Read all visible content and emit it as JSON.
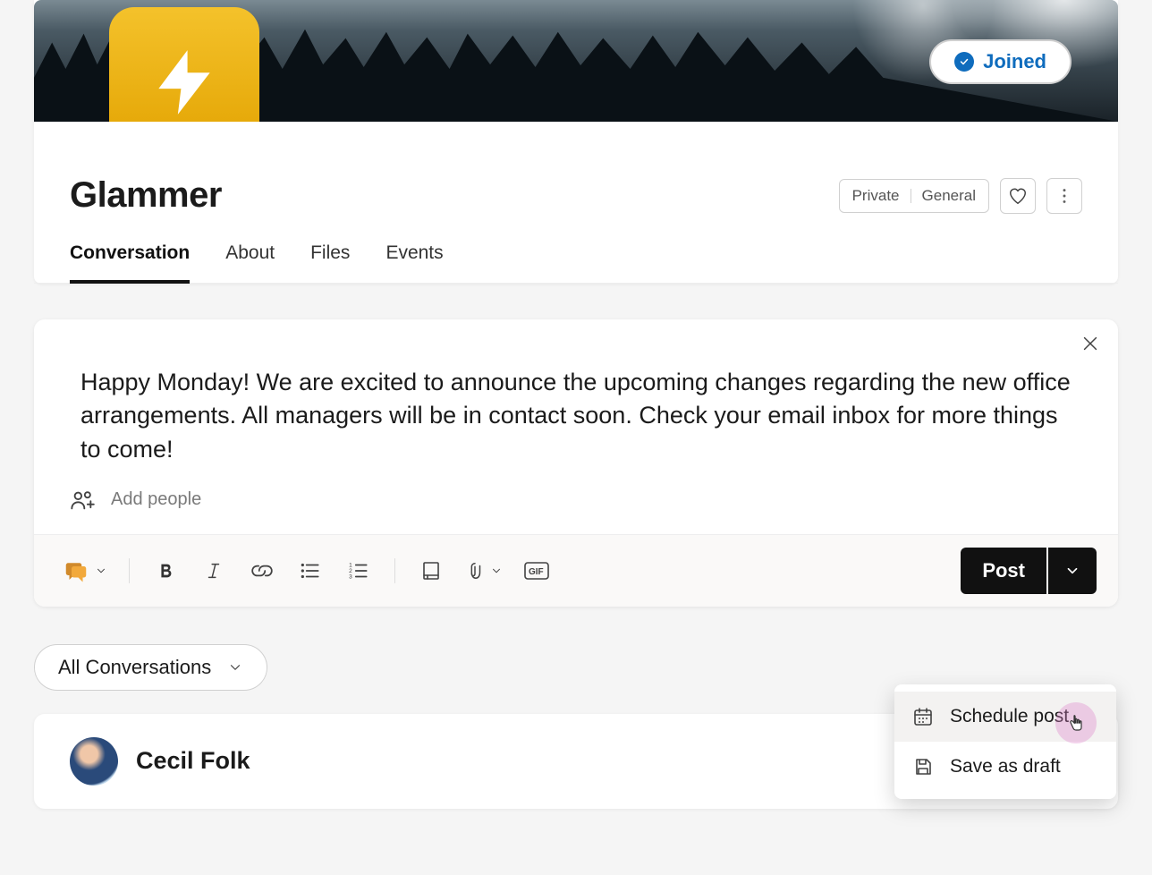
{
  "community": {
    "name": "Glammer",
    "join_status": "Joined",
    "privacy": "Private",
    "category": "General"
  },
  "tabs": [
    {
      "label": "Conversation",
      "active": true
    },
    {
      "label": "About",
      "active": false
    },
    {
      "label": "Files",
      "active": false
    },
    {
      "label": "Events",
      "active": false
    }
  ],
  "composer": {
    "body": "Happy Monday! We are excited to announce the upcoming changes regarding the new office arrangements. All managers will be in contact soon. Check your email inbox for more things to come!",
    "add_people_placeholder": "Add people",
    "post_button": "Post",
    "toolbar_icons": [
      "discussion-icon",
      "bold-icon",
      "italic-icon",
      "link-icon",
      "bullet-list-icon",
      "numbered-list-icon",
      "book-icon",
      "attachment-icon",
      "gif-icon"
    ]
  },
  "post_menu": {
    "items": [
      {
        "label": "Schedule post",
        "icon": "calendar-icon"
      },
      {
        "label": "Save as draft",
        "icon": "save-icon"
      }
    ]
  },
  "filter": {
    "label": "All Conversations"
  },
  "feed": {
    "author": "Cecil Folk"
  }
}
